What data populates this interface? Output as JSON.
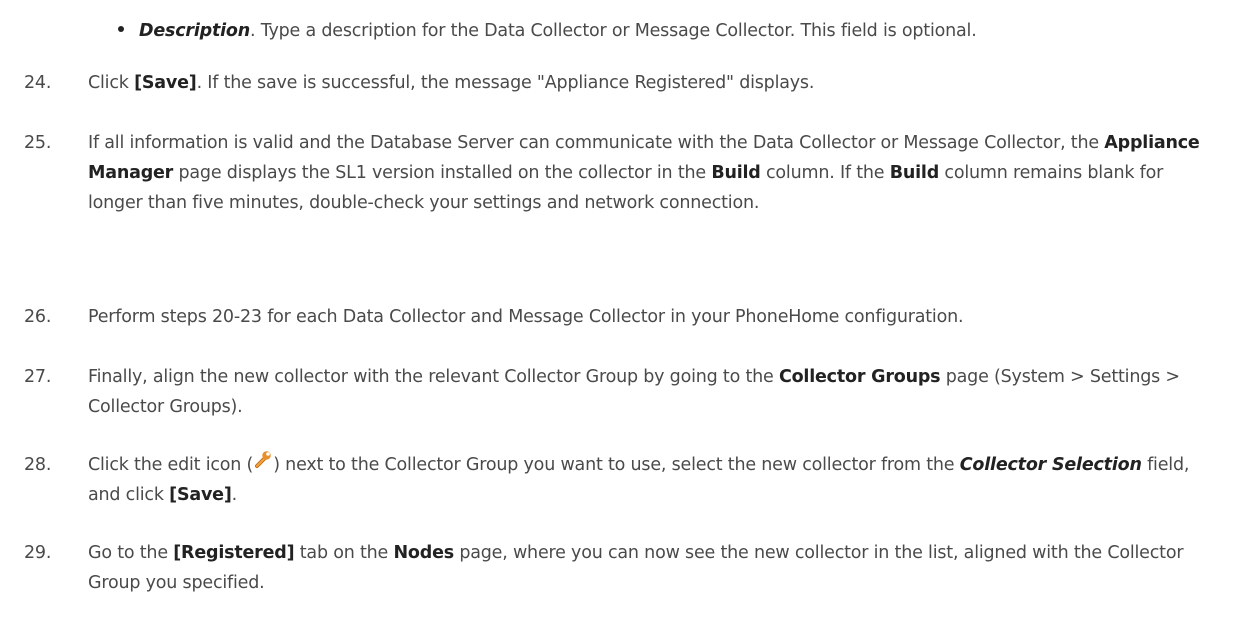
{
  "bullet": {
    "term": "Description",
    "text": ". Type a description for the Data Collector or Message Collector. This field is optional."
  },
  "steps": {
    "s24": {
      "num": "24.",
      "p1": "Click ",
      "save": "[Save]",
      "p2": ". If the save is successful, the message \"Appliance Registered\" displays."
    },
    "s25": {
      "num": "25.",
      "p1": "If all information is valid and the Database Server can communicate with the Data Collector or Message Collector, the ",
      "appliance_manager": "Appliance Manager",
      "p2": " page displays the SL1 version installed on the collector in the ",
      "build1": "Build",
      "p3": " column. If the ",
      "build2": "Build",
      "p4": " column remains blank for longer than five minutes, double-check your settings and network connection."
    },
    "s26": {
      "num": "26.",
      "text": "Perform steps 20-23 for each Data Collector and Message Collector in your PhoneHome configuration."
    },
    "s27": {
      "num": "27.",
      "p1": "Finally, align the new collector with the relevant Collector Group by going to the ",
      "collector_groups": "Collector Groups",
      "p2": " page (System > Settings > Collector Groups)."
    },
    "s28": {
      "num": "28.",
      "p1": "Click the edit icon (",
      "p2": ") next to the Collector Group you want to use, select the new collector from the ",
      "field": "Collector Selection",
      "p3": " field, and click ",
      "save": "[Save]",
      "p4": "."
    },
    "s29": {
      "num": "29.",
      "p1": "Go to the ",
      "registered": "[Registered]",
      "p2": " tab on the ",
      "nodes": "Nodes",
      "p3": " page, where you can now see the new collector in the list, aligned with the Collector Group you specified."
    }
  },
  "icons": {
    "edit": "wrench-edit-icon"
  },
  "colors": {
    "text": "#4a4a4a",
    "emphasis": "#222222",
    "icon_orange": "#e8902a"
  }
}
